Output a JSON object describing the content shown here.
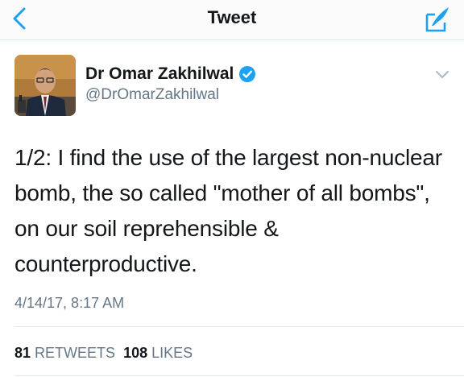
{
  "colors": {
    "accent": "#1da1f2",
    "text": "#14171a",
    "muted": "#657786",
    "divider": "#e1e8ed"
  },
  "navbar": {
    "title": "Tweet",
    "back_icon": "chevron-left-icon",
    "compose_icon": "compose-tweet-icon"
  },
  "author": {
    "name": "Dr Omar Zakhilwal",
    "handle": "@DrOmarZakhilwal",
    "verified": true
  },
  "tweet": {
    "text": "1/2: I find the use of the largest non-nuclear bomb, the so called \"mother of all bombs\", on our soil reprehensible & counterproductive.",
    "timestamp": "4/14/17, 8:17 AM"
  },
  "stats": {
    "retweets_count": "81",
    "retweets_label": "RETWEETS",
    "likes_count": "108",
    "likes_label": "LIKES"
  }
}
